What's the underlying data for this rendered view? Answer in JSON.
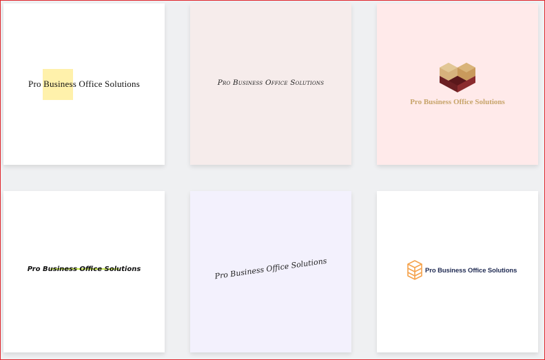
{
  "logos": [
    {
      "name": "Pro Business Office Solutions",
      "style": "serif with yellow highlight",
      "accent": "#fff1ab",
      "background": "#ffffff"
    },
    {
      "name": "Pro Business Office Solutions",
      "style": "handwritten small caps",
      "background": "#f6eceb"
    },
    {
      "name": "Pro Business Office Solutions",
      "style": "gold serif with heart blocks icon",
      "accent": "#c7a46a",
      "icon": "heart-blocks-icon",
      "background": "#ffeaea"
    },
    {
      "name": "Pro Business Office Solutions",
      "style": "bold italic with green underline",
      "accent": "#c6e84a",
      "background": "#ffffff"
    },
    {
      "name": "Pro Business Office Solutions",
      "style": "rotated script",
      "background": "#f3f1fd"
    },
    {
      "name": "Pro Business Office Solutions",
      "style": "navy sans with orange box icon",
      "accent": "#f5a24b",
      "icon": "box-outline-icon",
      "background": "#ffffff"
    }
  ]
}
